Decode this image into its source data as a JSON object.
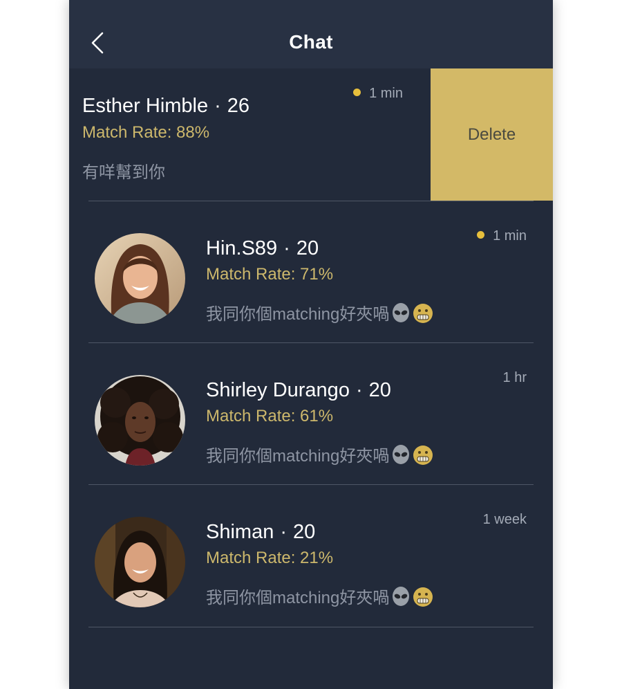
{
  "header": {
    "title": "Chat"
  },
  "conversations": [
    {
      "name": "Esther Himble",
      "age": "26",
      "match": "Match Rate: 88%",
      "message": "有咩幫到你",
      "time": "1 min",
      "unread": true,
      "swiped": true,
      "delete_label": "Delete"
    },
    {
      "name": "Hin.S89",
      "age": "20",
      "match": "Match Rate: 71%",
      "message": "我同你個matching好夾喎",
      "time": "1 min",
      "unread": true,
      "avatar": "avatar-brown-hair-woman"
    },
    {
      "name": "Shirley Durango",
      "age": "20",
      "match": "Match Rate: 61%",
      "message": "我同你個matching好夾喎",
      "time": "1 hr",
      "unread": false,
      "avatar": "avatar-curly-hair-woman"
    },
    {
      "name": "Shiman",
      "age": "20",
      "match": "Match Rate: 21%",
      "message": "我同你個matching好夾喎",
      "time": "1 week",
      "unread": false,
      "avatar": "avatar-dark-hair-woman"
    }
  ],
  "sep": "·",
  "message_emojis": [
    "alien-emoji",
    "grimacing-face-emoji"
  ],
  "colors": {
    "background": "#222a3a",
    "header": "#283143",
    "match_rate": "#cdb86c",
    "delete_bg": "#d3b967",
    "unread_dot": "#e7bf3c"
  }
}
